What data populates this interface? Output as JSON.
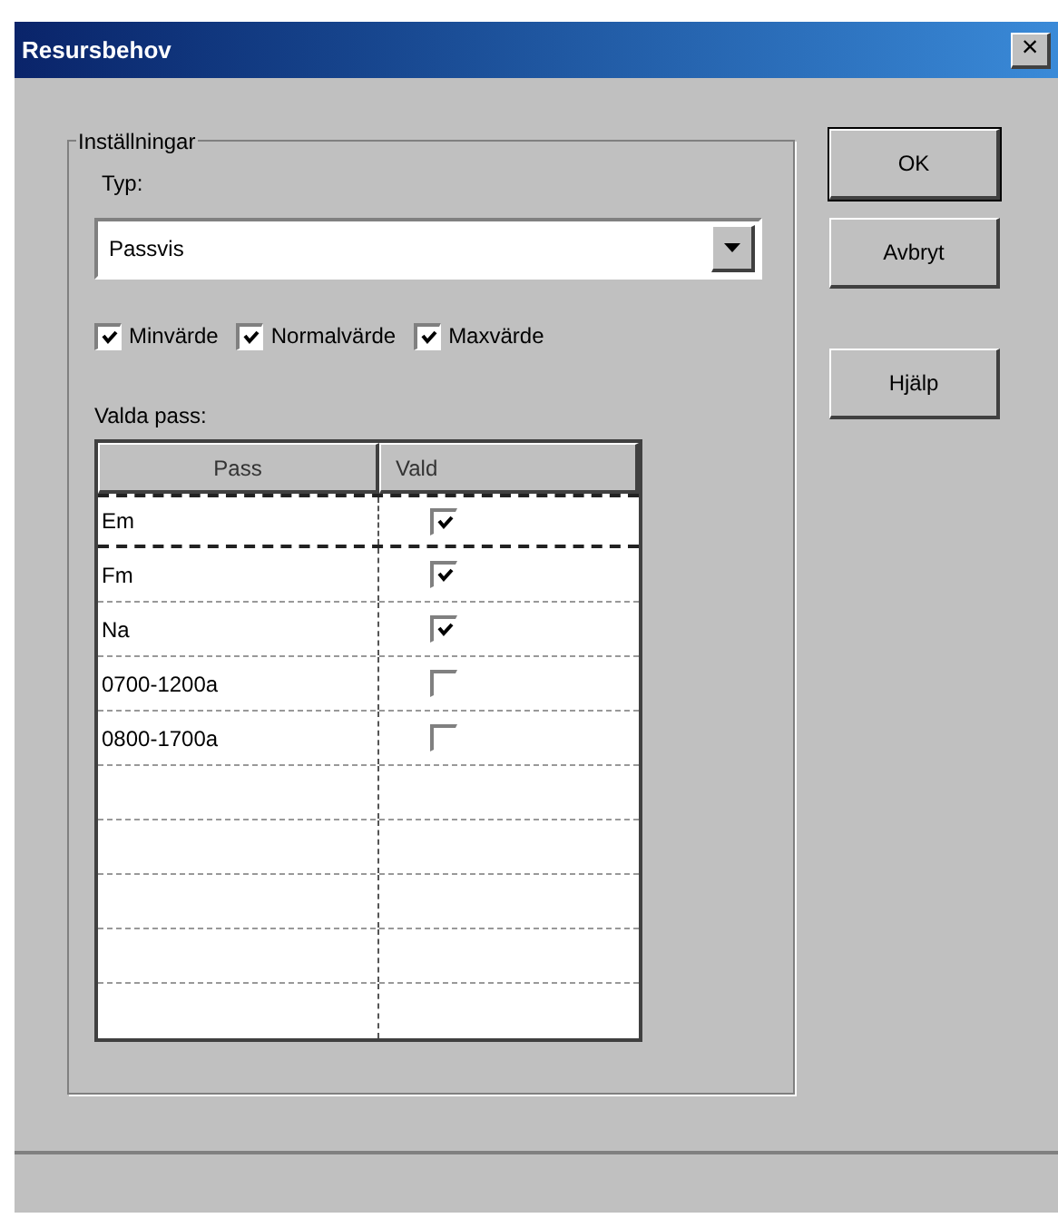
{
  "window": {
    "title": "Resursbehov",
    "close": "×"
  },
  "group": {
    "title": "Inställningar",
    "type_label": "Typ:",
    "type_value": "Passvis",
    "checkboxes": [
      {
        "label": "Minvärde",
        "checked": true
      },
      {
        "label": "Normalvärde",
        "checked": true
      },
      {
        "label": "Maxvärde",
        "checked": true
      }
    ],
    "list_label": "Valda pass:"
  },
  "table": {
    "columns": [
      "Pass",
      "Vald"
    ],
    "rows": [
      {
        "pass": "Em",
        "checked": true,
        "selected": true
      },
      {
        "pass": "Fm",
        "checked": true,
        "selected": false
      },
      {
        "pass": "Na",
        "checked": true,
        "selected": false
      },
      {
        "pass": "0700-1200a",
        "checked": false,
        "selected": false
      },
      {
        "pass": "0800-1700a",
        "checked": false,
        "selected": false
      }
    ]
  },
  "buttons": [
    "OK",
    "Avbryt",
    "Hjälp"
  ]
}
